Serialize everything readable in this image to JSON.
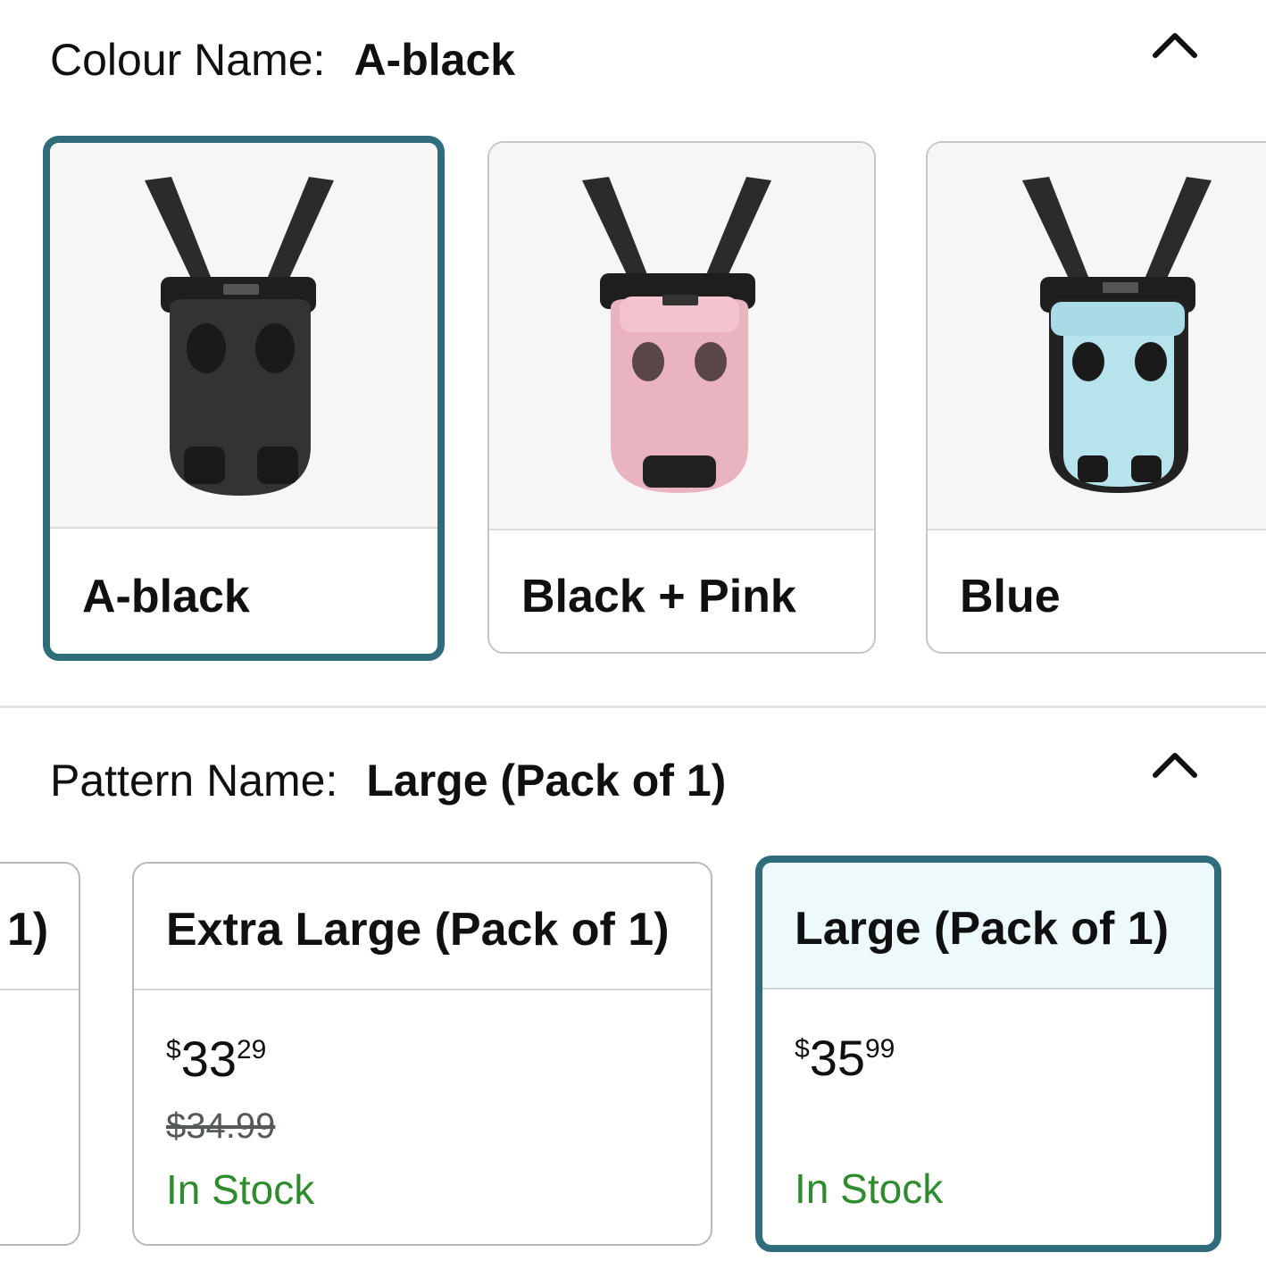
{
  "colour": {
    "label": "Colour Name:",
    "selected_value": "A-black",
    "swatches": [
      {
        "label": "A-black",
        "icon": "pet-carrier-black"
      },
      {
        "label": "Black + Pink",
        "icon": "pet-carrier-pink"
      },
      {
        "label": "Blue",
        "icon": "pet-carrier-blue"
      }
    ]
  },
  "pattern": {
    "label": "Pattern Name:",
    "selected_value": "Large (Pack of 1)",
    "partial_card_text": "1)",
    "cards": [
      {
        "title": "Extra Large (Pack of 1)",
        "currency": "$",
        "whole": "33",
        "fraction": "29",
        "was_price": "$34.99",
        "stock": "In Stock"
      },
      {
        "title": "Large (Pack of 1)",
        "currency": "$",
        "whole": "35",
        "fraction": "99",
        "stock": "In Stock"
      }
    ]
  },
  "colors": {
    "selected_border": "#2f6d7d",
    "in_stock": "#2e8b2e",
    "selected_bg": "#eef9fb"
  }
}
